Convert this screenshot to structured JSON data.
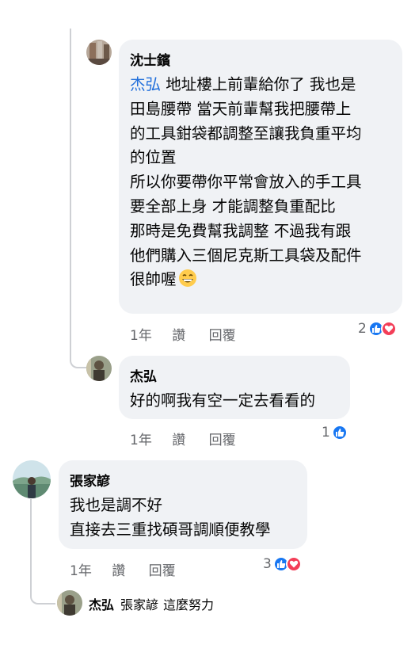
{
  "comments": [
    {
      "author": "沈士鑌",
      "mention": "杰弘",
      "lines": [
        "地址樓上前輩給你了 我也是",
        "田島腰帶 當天前輩幫我把腰帶上",
        "的工具鉗袋都調整至讓我負重平均",
        "的位置",
        "所以你要帶你平常會放入的手工具",
        "要全部上身 才能調整負重配比",
        "那時是免費幫我調整 不過我有跟",
        "他們購入三個尼克斯工具袋及配件",
        "很帥喔"
      ],
      "emoji": "grinning-face-with-smiling-eyes",
      "time": "1年",
      "like_label": "讚",
      "reply_label": "回覆",
      "reaction_count": "2",
      "reactions": [
        "like",
        "love"
      ]
    },
    {
      "author": "杰弘",
      "lines": [
        "好的啊我有空一定去看看的"
      ],
      "time": "1年",
      "like_label": "讚",
      "reply_label": "回覆",
      "reaction_count": "1",
      "reactions": [
        "like"
      ]
    },
    {
      "author": "張家諺",
      "lines": [
        "我也是調不好",
        "直接去三重找碩哥調順便教學"
      ],
      "time": "1年",
      "like_label": "讚",
      "reply_label": "回覆",
      "reaction_count": "3",
      "reactions": [
        "like",
        "love"
      ]
    }
  ],
  "collapsed_reply": {
    "author": "杰弘",
    "mention": "張家諺",
    "text": "這麼努力"
  },
  "colors": {
    "bubble": "#f0f2f5",
    "mention": "#216fdb",
    "meta": "#65676b",
    "like": "#1877f2",
    "love": "#f33e58",
    "thread_line": "#ced0d4"
  }
}
